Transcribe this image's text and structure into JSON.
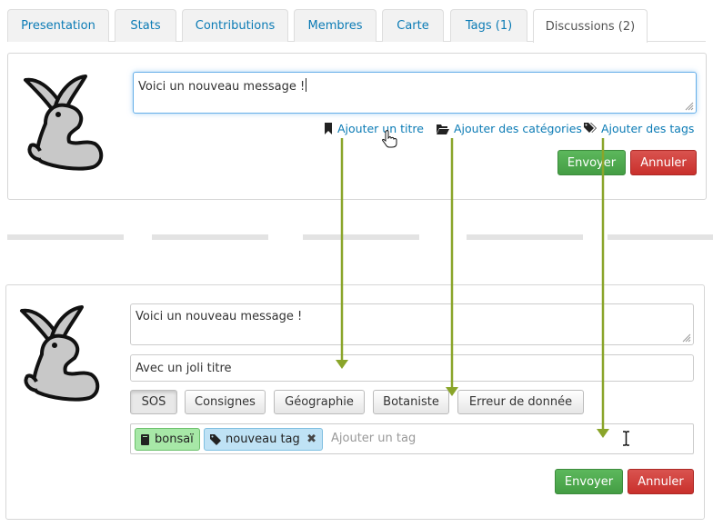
{
  "tabs": [
    {
      "label": "Presentation"
    },
    {
      "label": "Stats"
    },
    {
      "label": "Contributions"
    },
    {
      "label": "Membres"
    },
    {
      "label": "Carte"
    },
    {
      "label": "Tags (1)"
    },
    {
      "label": "Discussions (2)"
    }
  ],
  "top_form": {
    "message": "Voici un nouveau message !",
    "links": {
      "add_title": "Ajouter un titre",
      "add_categories": "Ajouter des catégories",
      "add_tags": "Ajouter des tags"
    },
    "send_label": "Envoyer",
    "cancel_label": "Annuler"
  },
  "bottom_form": {
    "message": "Voici un nouveau message !",
    "title": "Avec un joli titre",
    "categories": [
      "SOS",
      "Consignes",
      "Géographie",
      "Botaniste",
      "Erreur de donnée"
    ],
    "tags": [
      "bonsaï",
      "nouveau tag"
    ],
    "tag_placeholder": "Ajouter un tag",
    "send_label": "Envoyer",
    "cancel_label": "Annuler"
  },
  "colors": {
    "link": "#0b7bb5",
    "send": "#5cb85c",
    "cancel": "#d9534f",
    "arrow": "#8aa52a",
    "tag_green": "#a7e8a7",
    "tag_blue": "#bfe2f5"
  }
}
